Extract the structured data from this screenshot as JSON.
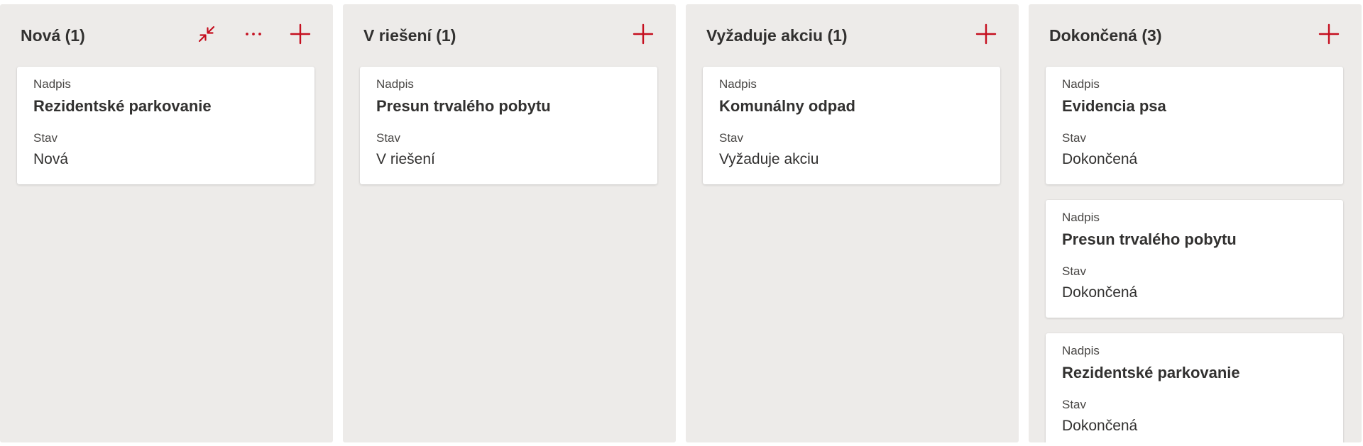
{
  "theme": {
    "accent": "#c50f1f",
    "column_bg": "#edebe9",
    "card_bg": "#ffffff",
    "text": "#323130"
  },
  "columns": [
    {
      "title": "Nová (1)",
      "actions": [
        "collapse-icon",
        "more-icon",
        "add-icon"
      ],
      "cards": [
        {
          "title_label": "Nadpis",
          "title": "Rezidentské parkovanie",
          "status_label": "Stav",
          "status": "Nová"
        }
      ]
    },
    {
      "title": "V riešení (1)",
      "actions": [
        "add-icon"
      ],
      "cards": [
        {
          "title_label": "Nadpis",
          "title": "Presun trvalého pobytu",
          "status_label": "Stav",
          "status": "V riešení"
        }
      ]
    },
    {
      "title": "Vyžaduje akciu (1)",
      "actions": [
        "add-icon"
      ],
      "cards": [
        {
          "title_label": "Nadpis",
          "title": "Komunálny odpad",
          "status_label": "Stav",
          "status": "Vyžaduje akciu"
        }
      ]
    },
    {
      "title": "Dokončená (3)",
      "actions": [
        "add-icon"
      ],
      "cards": [
        {
          "title_label": "Nadpis",
          "title": "Evidencia psa",
          "status_label": "Stav",
          "status": "Dokončená"
        },
        {
          "title_label": "Nadpis",
          "title": "Presun trvalého pobytu",
          "status_label": "Stav",
          "status": "Dokončená"
        },
        {
          "title_label": "Nadpis",
          "title": "Rezidentské parkovanie",
          "status_label": "Stav",
          "status": "Dokončená"
        }
      ]
    }
  ]
}
